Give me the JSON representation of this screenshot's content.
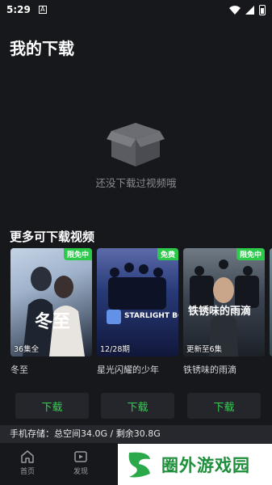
{
  "status": {
    "time": "5:29",
    "notif": "A"
  },
  "page": {
    "title": "我的下载"
  },
  "empty": {
    "text": "还没下载过视频哦"
  },
  "section": {
    "title": "更多可下载视频"
  },
  "cards": [
    {
      "title": "冬至",
      "episodes": "36集全",
      "badge": "限免中",
      "poster_text": "冬至"
    },
    {
      "title": "星光闪耀的少年",
      "episodes": "12/28期",
      "badge": "免费",
      "poster_text": "STARLIGHT BOYS"
    },
    {
      "title": "铁锈味的雨滴",
      "episodes": "更新至6集",
      "badge": "限免中",
      "poster_text": "铁锈味的雨滴"
    },
    {
      "title": "",
      "episodes": "",
      "badge": "",
      "poster_text": ""
    }
  ],
  "download_label": "下载",
  "storage": {
    "text": "手机存储：总空间34.0G / 剩余30.8G"
  },
  "nav": [
    {
      "label": "首页",
      "icon": "home-icon"
    },
    {
      "label": "发现",
      "icon": "discover-icon"
    }
  ],
  "watermark": {
    "text": "圈外游戏园"
  },
  "colors": {
    "accent": "#35cf52",
    "badge": "#2cc94b",
    "background": "#17181c"
  }
}
